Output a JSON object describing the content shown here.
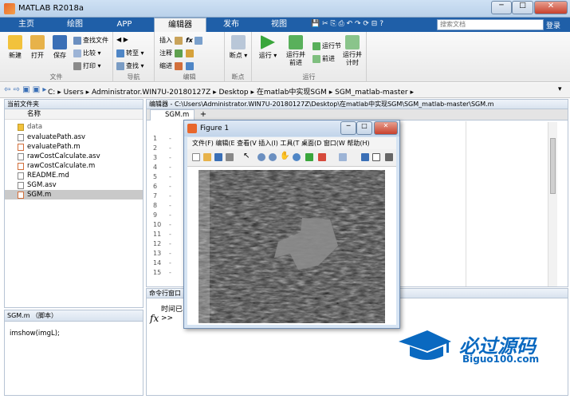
{
  "window": {
    "title": "MATLAB R2018a",
    "minimize": "─",
    "maximize": "□",
    "close": "✕"
  },
  "ribbon_tabs": [
    "主页",
    "绘图",
    "APP",
    "编辑器",
    "发布",
    "视图"
  ],
  "search": {
    "placeholder": "搜索文档",
    "login": "登录"
  },
  "ribbon": {
    "file_group": {
      "label": "文件",
      "new": "新建",
      "open": "打开",
      "save": "保存",
      "find_files": "查找文件",
      "compare": "比较",
      "print": "打印"
    },
    "nav_group": {
      "label": "导航",
      "goto": "转至",
      "find": "查找"
    },
    "edit_group": {
      "label": "编辑",
      "insert": "插入",
      "comment": "注释",
      "indent": "缩进"
    },
    "breakpoints_group": {
      "label": "断点",
      "breakpoints": "断点"
    },
    "run_group": {
      "label": "运行",
      "run": "运行",
      "run_advance": "运行并\n前进",
      "run_section": "运行节",
      "advance": "前进",
      "run_time": "运行并\n计时"
    }
  },
  "address": {
    "path": [
      "C:",
      "Users",
      "Administrator.WIN7U-20180127Z",
      "Desktop",
      "在matlab中实现SGM",
      "SGM_matlab-master"
    ]
  },
  "current_folder": {
    "title": "当前文件夹",
    "column": "名称",
    "files": [
      "data",
      "evaluatePath.asv",
      "evaluatePath.m",
      "rawCostCalculate.asv",
      "rawCostCalculate.m",
      "README.md",
      "SGM.asv",
      "SGM.m"
    ],
    "selected": "SGM.m"
  },
  "details": {
    "title": "SGM.m （脚本）",
    "code": "imshow(imgL);"
  },
  "editor": {
    "title": "编辑器 - C:\\Users\\Administrator.WIN7U-20180127Z\\Desktop\\在matlab中实现SGM\\SGM_matlab-master\\SGM.m",
    "tab": "SGM.m",
    "add_tab": "+",
    "line_numbers": [
      "1",
      "2",
      "3",
      "4",
      "5",
      "6",
      "7",
      "8",
      "9",
      "10",
      "11",
      "12",
      "13",
      "14",
      "15"
    ]
  },
  "command": {
    "title": "命令行窗口",
    "text": "时间已",
    "prompt": ">>",
    "fx": "fx"
  },
  "figure": {
    "title": "Figure 1",
    "menu": [
      "文件(F)",
      "编辑(E",
      "查看(V",
      "插入(I)",
      "工具(T",
      "桌面(D",
      "窗口(W",
      "帮助(H)"
    ]
  },
  "watermark": {
    "brand": "必过源码",
    "url": "Biguo100.com"
  },
  "colors": {
    "ribbon_tab_bg": "#1f5fa8",
    "accent": "#0a69c0"
  }
}
